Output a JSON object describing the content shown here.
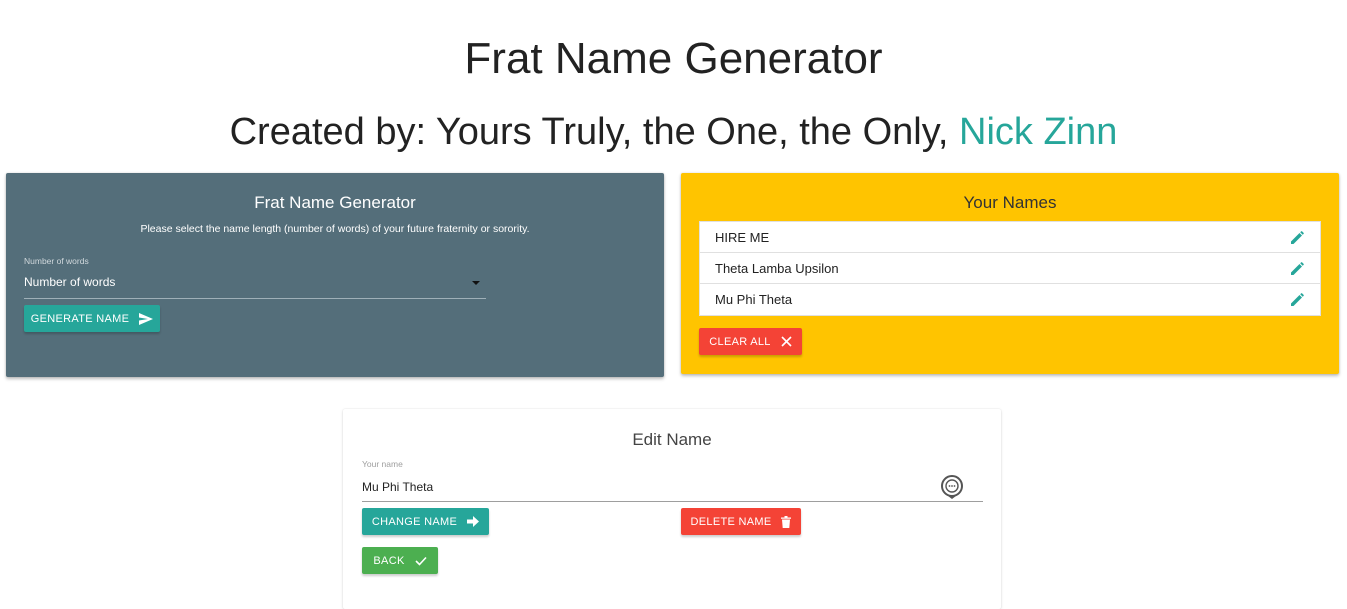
{
  "header": {
    "title": "Frat Name Generator",
    "subtitle_prefix": "Created by: Yours Truly, the One, the Only, ",
    "author": "Nick Zinn"
  },
  "generator": {
    "title": "Frat Name Generator",
    "description": "Please select the name length (number of words) of your future fraternity or sorority.",
    "select_label": "Number of words",
    "select_value": "Number of words",
    "generate_button": "GENERATE NAME"
  },
  "names": {
    "title": "Your Names",
    "items": [
      {
        "label": "HIRE ME"
      },
      {
        "label": "Theta Lamba Upsilon"
      },
      {
        "label": "Mu Phi Theta"
      }
    ],
    "clear_button": "CLEAR ALL"
  },
  "edit": {
    "title": "Edit Name",
    "field_label": "Your name",
    "field_value": "Mu Phi Theta",
    "change_button": "CHANGE NAME",
    "delete_button": "DELETE NAME",
    "back_button": "BACK"
  },
  "colors": {
    "accent": "#26a69a",
    "generator_bg": "#546e7a",
    "names_bg": "#ffc400",
    "danger": "#f44336",
    "success": "#4caf50"
  },
  "icons": {
    "generate": "send-icon",
    "edit": "pencil-icon",
    "clear": "close-icon",
    "change": "arrow-right-icon",
    "delete": "trash-icon",
    "back": "check-icon",
    "field_accessory": "chat-bubble-icon"
  }
}
